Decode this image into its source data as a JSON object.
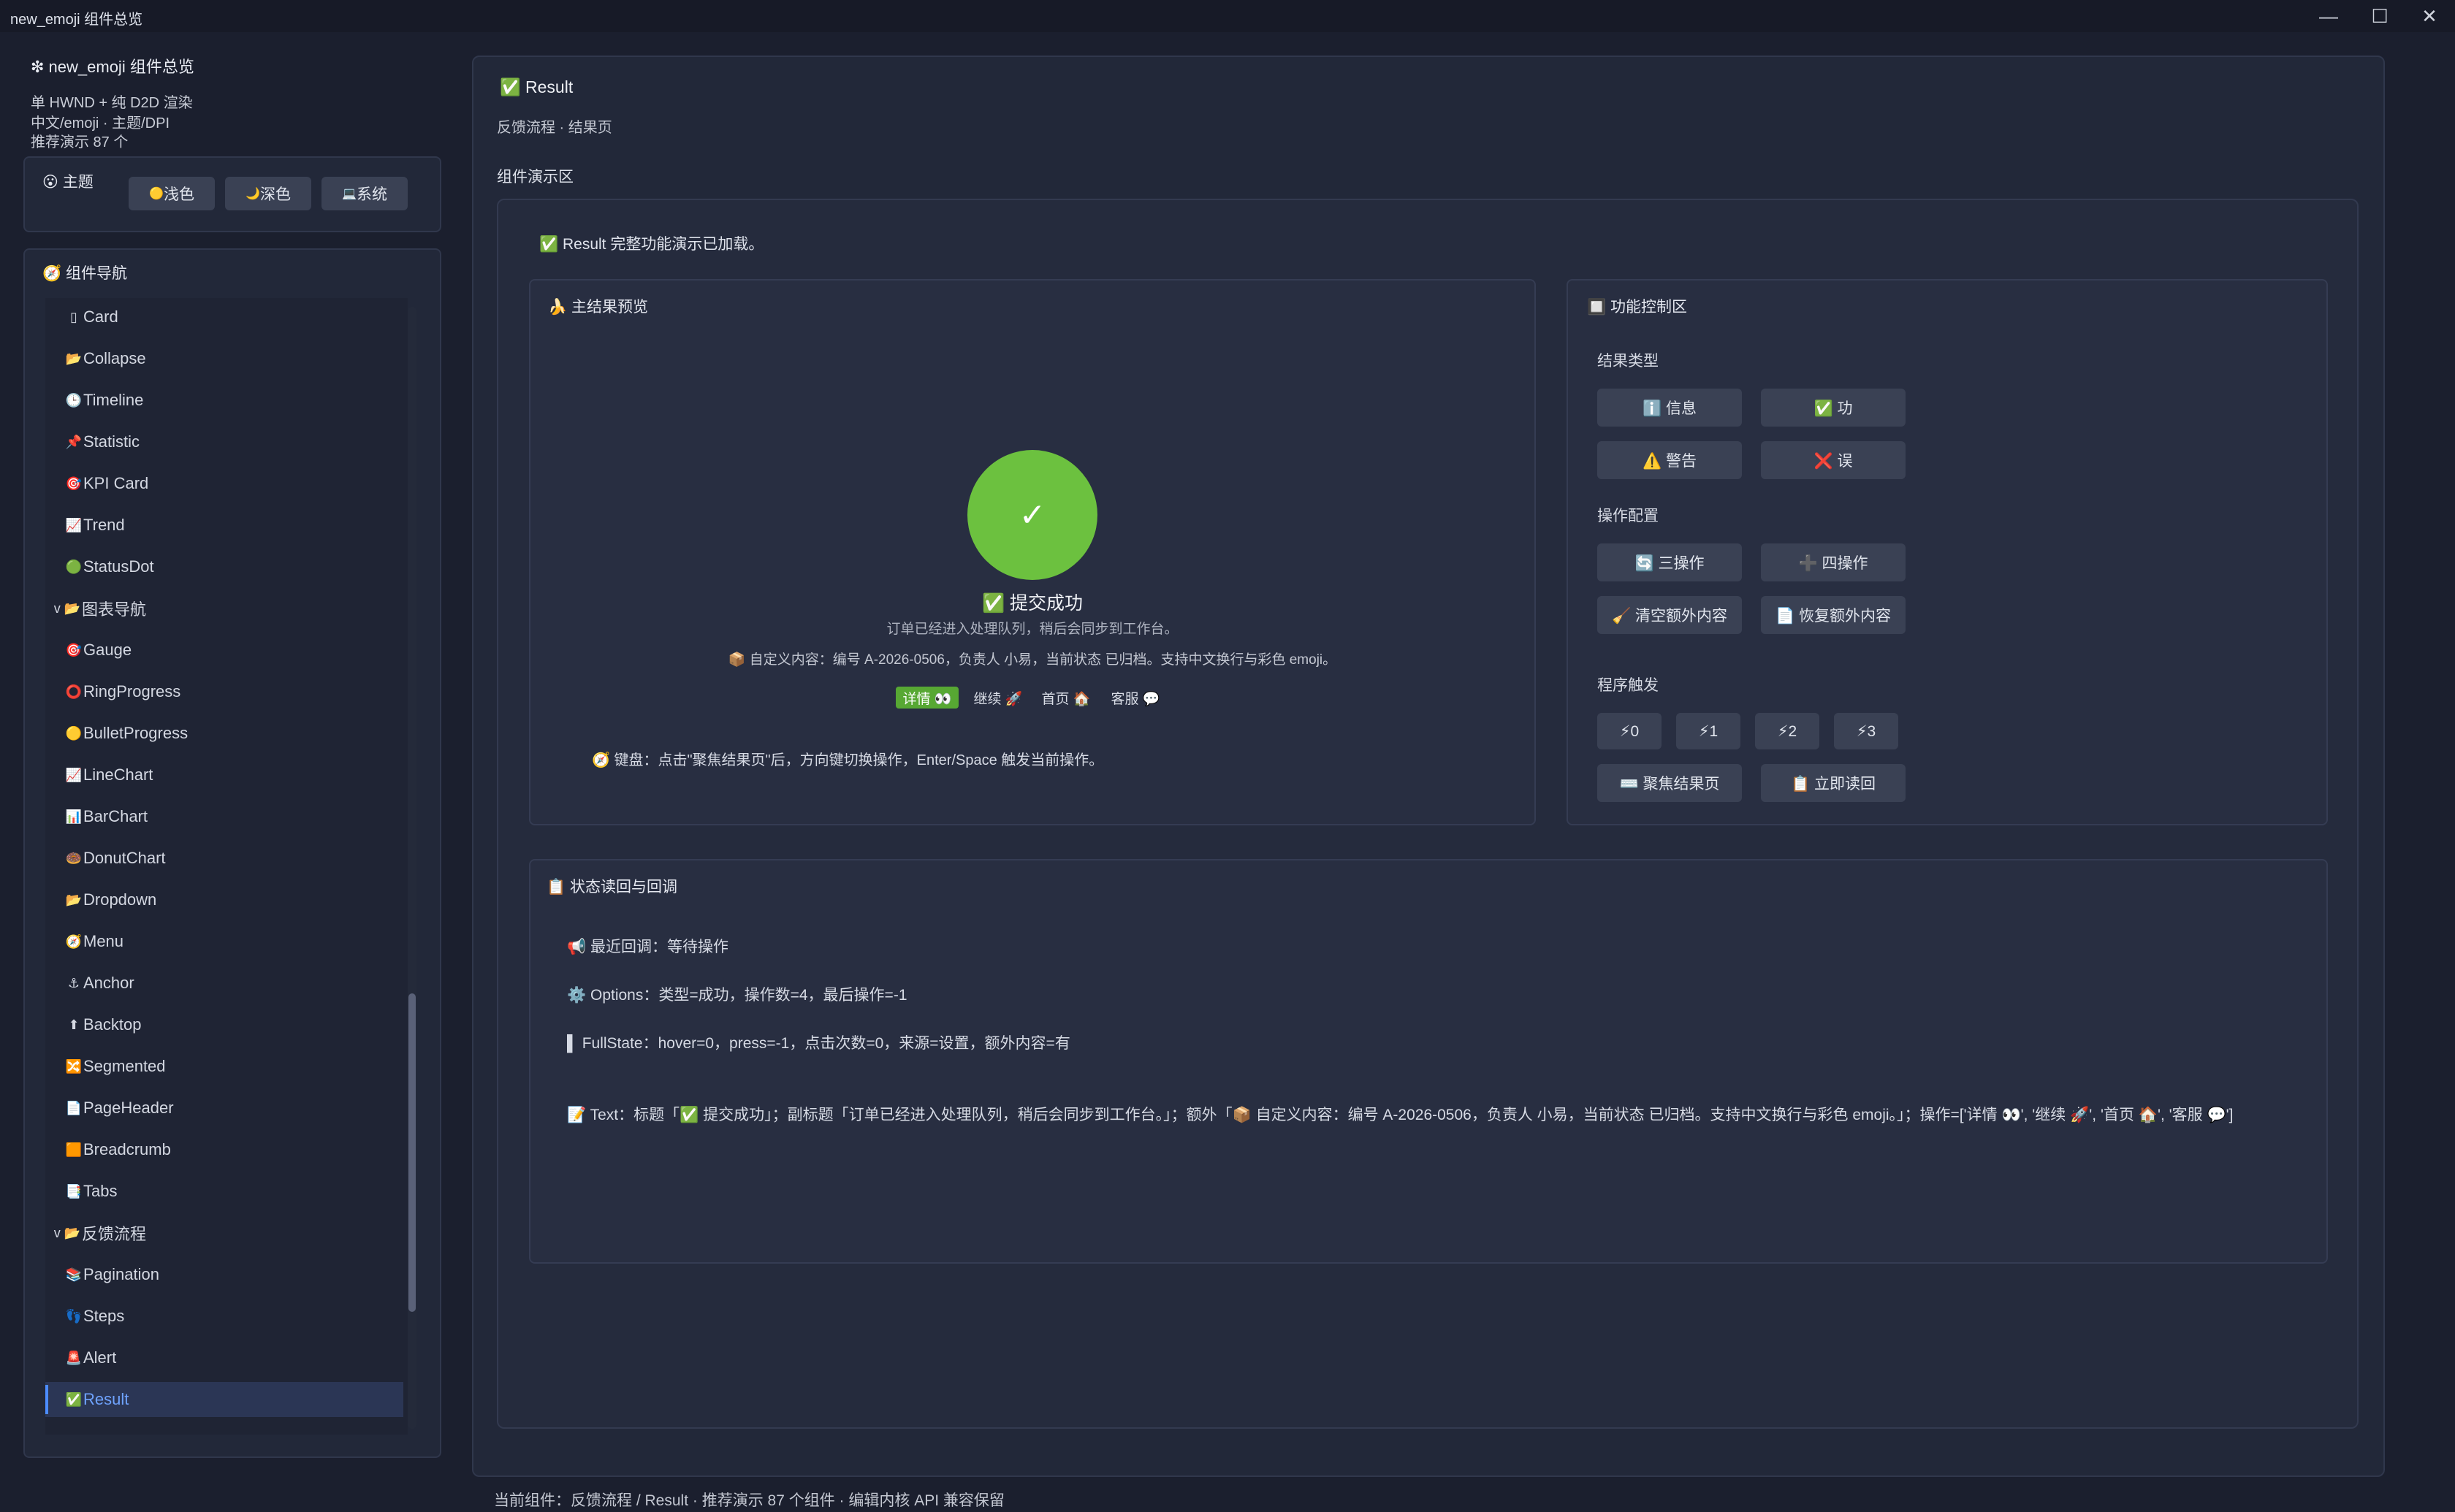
{
  "window": {
    "title": "new_emoji 组件总览",
    "icon": "❇",
    "controls": {
      "minimize": "—",
      "maximize": "☐",
      "close": "✕"
    }
  },
  "sidebar": {
    "app_title": "❇ new_emoji 组件总览",
    "info_lines": [
      "单 HWND + 纯 D2D 渲染",
      "中文/emoji · 主题/DPI",
      "推荐演示 87 个"
    ],
    "theme": {
      "label": "😮 主题",
      "buttons": [
        {
          "icon": "🟡",
          "label": "浅色"
        },
        {
          "icon": "🌙",
          "label": "深色"
        },
        {
          "icon": "💻",
          "label": "系统"
        }
      ]
    },
    "nav": {
      "title": "🧭 组件导航",
      "items": [
        {
          "icon": "▯",
          "label": "Card"
        },
        {
          "icon": "📂",
          "label": "Collapse"
        },
        {
          "icon": "🕒",
          "label": "Timeline"
        },
        {
          "icon": "📌",
          "label": "Statistic"
        },
        {
          "icon": "🎯",
          "label": "KPI Card"
        },
        {
          "icon": "📈",
          "label": "Trend"
        },
        {
          "icon": "🟢",
          "label": "StatusDot"
        },
        {
          "icon": "v 📂",
          "label": "图表导航"
        },
        {
          "icon": "🎯",
          "label": "Gauge"
        },
        {
          "icon": "⭕",
          "label": "RingProgress"
        },
        {
          "icon": "🟡",
          "label": "BulletProgress"
        },
        {
          "icon": "📈",
          "label": "LineChart"
        },
        {
          "icon": "📊",
          "label": "BarChart"
        },
        {
          "icon": "🍩",
          "label": "DonutChart"
        },
        {
          "icon": "📂",
          "label": "Dropdown"
        },
        {
          "icon": "🧭",
          "label": "Menu"
        },
        {
          "icon": "⚓",
          "label": "Anchor"
        },
        {
          "icon": "⬆",
          "label": "Backtop"
        },
        {
          "icon": "🔀",
          "label": "Segmented"
        },
        {
          "icon": "📄",
          "label": "PageHeader"
        },
        {
          "icon": "🟧",
          "label": "Breadcrumb"
        },
        {
          "icon": "📑",
          "label": "Tabs"
        },
        {
          "icon": "v 📂",
          "label": "反馈流程"
        },
        {
          "icon": "📚",
          "label": "Pagination"
        },
        {
          "icon": "👣",
          "label": "Steps"
        },
        {
          "icon": "🚨",
          "label": "Alert"
        },
        {
          "icon": "✅",
          "label": "Result"
        }
      ],
      "active_index": 26
    }
  },
  "main": {
    "title": "✅ Result",
    "subtitle": "反馈流程 · 结果页",
    "demo_label": "组件演示区",
    "loaded_msg": "✅ Result 完整功能演示已加载。",
    "preview": {
      "title": "🍌 主结果预览",
      "icon_glyph": "✓",
      "result_title": "✅ 提交成功",
      "result_subtitle": "订单已经进入处理队列，稍后会同步到工作台。",
      "extra": "📦 自定义内容：编号 A-2026-0506，负责人 小易，当前状态 已归档。支持中文换行与彩色 emoji。",
      "actions": [
        "详情 👀",
        "继续 🚀",
        "首页 🏠",
        "客服 💬"
      ],
      "keyboard_hint": "🧭 键盘：点击\"聚焦结果页\"后，方向键切换操作，Enter/Space 触发当前操作。"
    },
    "controls": {
      "title": "🔲 功能控制区",
      "result_type_label": "结果类型",
      "result_types": [
        "ℹ️ 信息",
        "✅ 功",
        "⚠️ 警告",
        "❌ 误"
      ],
      "op_config_label": "操作配置",
      "op_config": [
        "🔄 三操作",
        "➕ 四操作",
        "🧹 清空额外内容",
        "📄 恢复额外内容"
      ],
      "trigger_label": "程序触发",
      "triggers": [
        "⚡0",
        "⚡1",
        "⚡2",
        "⚡3"
      ],
      "trigger_actions": [
        "⌨️ 聚焦结果页",
        "📋 立即读回"
      ]
    },
    "status": {
      "title": "📋 状态读回与回调",
      "last_callback": "📢 最近回调：等待操作",
      "options": "⚙️ Options：类型=成功，操作数=4，最后操作=-1",
      "full_state": "▌ FullState：hover=0，press=-1，点击次数=0，来源=设置，额外内容=有",
      "text": "📝 Text：标题「✅ 提交成功」；副标题「订单已经进入处理队列，稍后会同步到工作台。」；额外「📦 自定义内容：编号 A-2026-0506，负责人 小易，当前状态 已归档。支持中文换行与彩色 emoji。」；操作=['详情 👀', '继续 🚀', '首页 🏠', '客服 💬']"
    }
  },
  "footer": "当前组件：反馈流程 / Result · 推荐演示 87 个组件 · 编辑内核 API 兼容保留",
  "colors": {
    "success": "#6cc13f",
    "accent": "#4c8cff",
    "bg": "#1b1f2e",
    "panel": "#222839"
  }
}
